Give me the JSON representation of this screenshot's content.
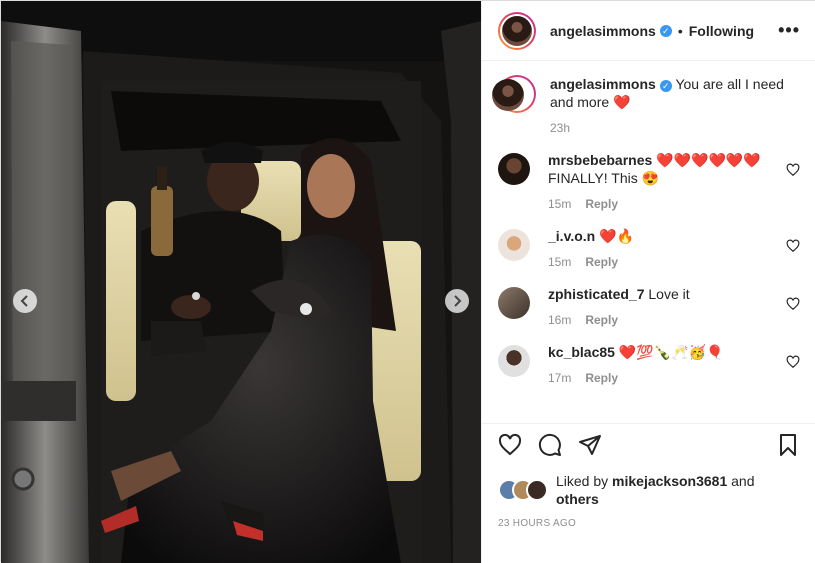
{
  "post": {
    "author": "angelasimmons",
    "follow_status": "Following",
    "more_icon": "more-horizontal-icon",
    "caption_text": "You are all I need and more ❤️",
    "caption_time": "23h"
  },
  "comments": [
    {
      "user": "mrsbebebarnes",
      "text": "❤️❤️❤️❤️❤️❤️ FINALLY! This 😍",
      "time": "15m",
      "reply": "Reply"
    },
    {
      "user": "_i.v.o.n",
      "text": "❤️🔥",
      "time": "15m",
      "reply": "Reply"
    },
    {
      "user": "zphisticated_7",
      "text": "Love it",
      "time": "16m",
      "reply": "Reply"
    },
    {
      "user": "kc_blac85",
      "text": "❤️💯🍾🥂🥳🎈",
      "time": "17m",
      "reply": "Reply"
    }
  ],
  "actions": {
    "like_icon": "heart-icon",
    "comment_icon": "comment-icon",
    "share_icon": "paper-plane-icon",
    "save_icon": "bookmark-icon"
  },
  "likes": {
    "prefix": "Liked by",
    "user": "mikejackson3681",
    "and": "and",
    "others": "others"
  },
  "timestamp": "23 HOURS AGO",
  "colors": {
    "verified": "#3897f0",
    "story_ring_start": "#f9a334",
    "story_ring_end": "#b52fa5",
    "muted_text": "#8e8e8e"
  }
}
